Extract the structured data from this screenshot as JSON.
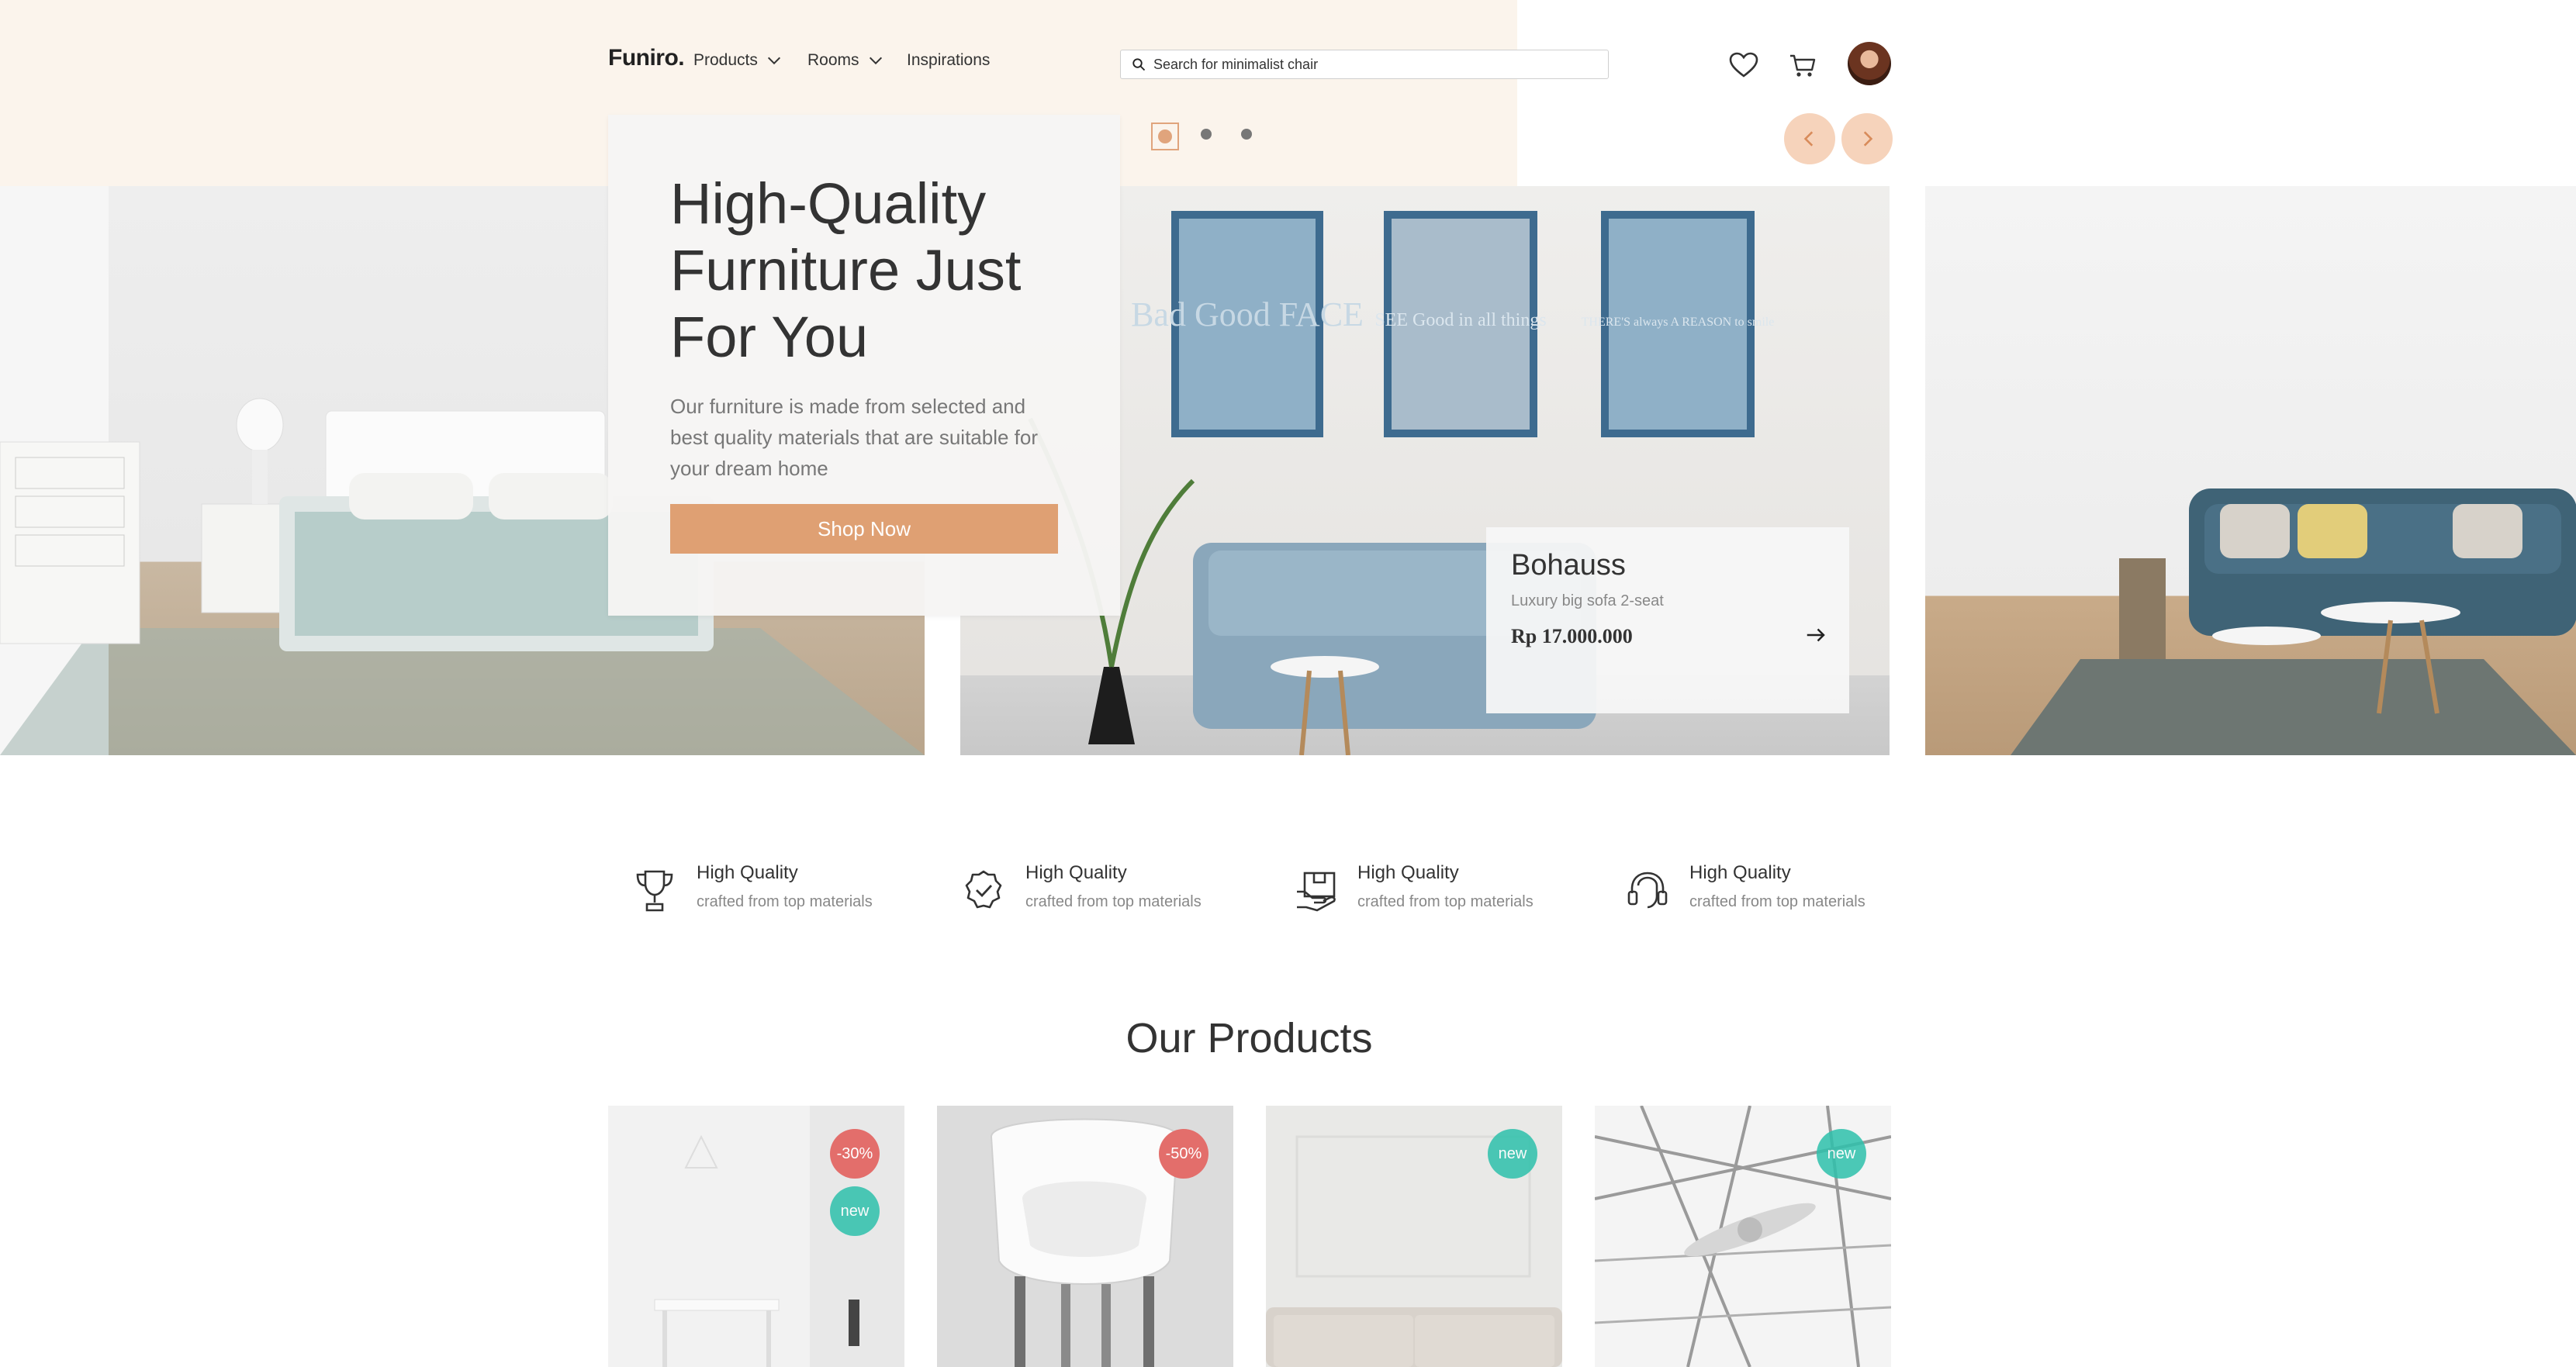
{
  "header": {
    "logo": "Funiro.",
    "nav": [
      {
        "label": "Products",
        "has_dropdown": true
      },
      {
        "label": "Rooms",
        "has_dropdown": true
      },
      {
        "label": "Inspirations",
        "has_dropdown": false
      }
    ],
    "search": {
      "placeholder": "Search for minimalist chair",
      "value": ""
    },
    "icons": [
      "heart-icon",
      "cart-icon"
    ]
  },
  "hero": {
    "title": "High-Quality Furniture Just For You",
    "description": "Our furniture is made from selected and best quality materials that are suitable for your dream home",
    "cta_label": "Shop Now",
    "carousel": {
      "active_dot": 1,
      "dot_count": 3
    },
    "featured_product": {
      "name": "Bohauss",
      "subtitle": "Luxury big sofa 2-seat",
      "price": "Rp  17.000.000"
    },
    "frames": [
      "Bad Good FACE",
      "SEE Good in all things",
      "THERE'S always A REASON to smile"
    ]
  },
  "features": [
    {
      "icon": "trophy-icon",
      "title": "High Quality",
      "subtitle": "crafted from top materials"
    },
    {
      "icon": "verified-badge-icon",
      "title": "High Quality",
      "subtitle": "crafted from top materials"
    },
    {
      "icon": "shipping-box-icon",
      "title": "High Quality",
      "subtitle": "crafted from top materials"
    },
    {
      "icon": "support-headset-icon",
      "title": "High Quality",
      "subtitle": "crafted from top materials"
    }
  ],
  "products": {
    "title": "Our Products",
    "items": [
      {
        "badges": [
          "-30%",
          "new"
        ]
      },
      {
        "badges": [
          "-50%"
        ]
      },
      {
        "badges": [
          "new"
        ]
      },
      {
        "badges": [
          "new"
        ]
      }
    ]
  },
  "colors": {
    "accent": "#DFA073",
    "top_band": "#FBF4EC",
    "badge_discount": "#E36E6B",
    "badge_new": "#2EC1AC"
  }
}
